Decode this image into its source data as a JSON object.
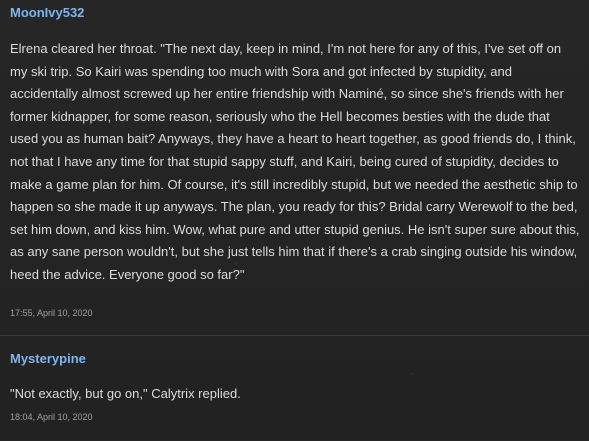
{
  "posts": [
    {
      "author": "MoonIvy532",
      "body": "Elrena cleared her throat. \"The next day, keep in mind, I'm not here for any of this, I've set off on my ski trip. So Kairi was spending too much with Sora and got infected by stupidity, and accidentally almost screwed up her entire friendship with Naminé, so since she's friends with her former kidnapper, for some reason, seriously who the Hell becomes besties with the dude that used you as human bait? Anyways, they have a heart to heart together, as good friends do, I think, not that I have any time for that stupid sappy stuff, and Kairi, being cured of stupidity, decides to make a game plan for him. Of course, it's still incredibly stupid, but we needed the aesthetic ship to happen so she made it up anyways. The plan, you ready for this? Bridal carry Werewolf to the bed, set him down, and kiss him. Wow, what pure and utter stupid genius. He isn't super sure about this, as any sane person wouldn't, but she just tells him that if there's a crab singing outside his window, heed the advice. Everyone good so far?\"",
      "timestamp": "17:55, April 10, 2020"
    },
    {
      "author": "Mysterypine",
      "body": "\"Not exactly, but go on,\" Calytrix replied.",
      "timestamp": "18:04, April 10, 2020"
    }
  ],
  "colors": {
    "background": "#242424",
    "author": "#7fb5ee",
    "text": "#dcdcdc",
    "timestamp": "#a0a0a0",
    "divider": "#3a3a3a"
  }
}
